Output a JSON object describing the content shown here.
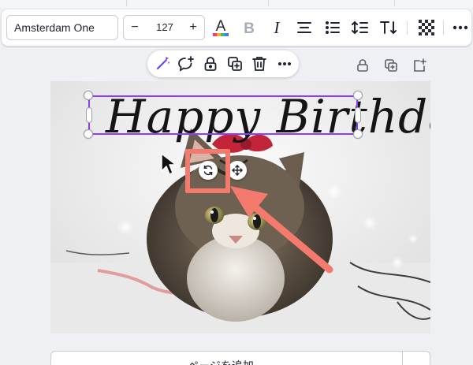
{
  "toolbar": {
    "font_name": "Amsterdam One",
    "size_minus": "−",
    "font_size": "127",
    "size_plus": "+",
    "icons": [
      "text-color-icon",
      "bold-icon",
      "italic-icon",
      "align-center-icon",
      "list-icon",
      "spacing-icon",
      "text-effects-icon",
      "transparency-icon",
      "more-icon"
    ]
  },
  "floating_toolbar": {
    "icons": [
      "magic-write-icon",
      "comment-icon",
      "lock-icon",
      "duplicate-icon",
      "delete-icon",
      "more-icon"
    ]
  },
  "page_actions": {
    "icons": [
      "lock-page-icon",
      "duplicate-page-icon",
      "add-page-icon"
    ]
  },
  "canvas": {
    "text": "Happy Birthday",
    "text_color": "#151515",
    "selection_color": "#8b3dff",
    "highlight_color": "#f37a6d",
    "controls": [
      "rotate-icon",
      "move-icon"
    ]
  },
  "add_page": {
    "label": "ページを追加"
  }
}
